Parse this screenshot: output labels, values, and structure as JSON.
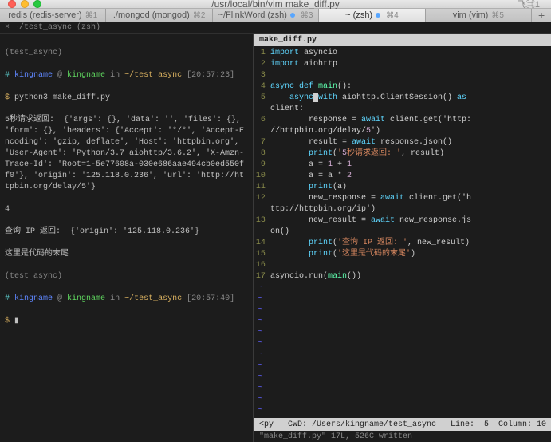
{
  "window": {
    "title": "/usr/local/bin/vim make_diff.py",
    "right_shortcut": "飞⌘1"
  },
  "tabs": [
    {
      "label": "redis (redis-server)",
      "hotkey": "⌘1",
      "indicator": null,
      "active": false
    },
    {
      "label": "./mongod (mongod)",
      "hotkey": "⌘2",
      "indicator": null,
      "active": false
    },
    {
      "label": "~/FlinkWord (zsh)",
      "hotkey": "⌘3",
      "indicator": "#58a6ff",
      "active": false
    },
    {
      "label": "~ (zsh)",
      "hotkey": "⌘4",
      "indicator": "#58a6ff",
      "active": true
    },
    {
      "label": "vim (vim)",
      "hotkey": "⌘5",
      "indicator": null,
      "active": false
    }
  ],
  "tmux_line": " × ~/test_async (zsh)",
  "left_pane": {
    "l1_env": "(test_async)",
    "l2_prefix": "# ",
    "l2_user": "kingname",
    "l2_at": " @ ",
    "l2_host": "kingname",
    "l2_in": " in ",
    "l2_path": "~/test_async",
    "l2_time": " [20:57:23]",
    "l3_prompt": "$ ",
    "l3_cmd": "python3 make_diff.py",
    "block": "5秒请求返回:  {'args': {}, 'data': '', 'files': {}, 'form': {}, 'headers': {'Accept': '*/*', 'Accept-Encoding': 'gzip, deflate', 'Host': 'httpbin.org', 'User-Agent': 'Python/3.7 aiohttp/3.6.2', 'X-Amzn-Trace-Id': 'Root=1-5e77608a-030e686aae494cb0ed550ff0'}, 'origin': '125.118.0.236', 'url': 'http://httpbin.org/delay/5'}",
    "l4": "4",
    "l5": "查询 IP 返回:  {'origin': '125.118.0.236'}",
    "l6": "这里是代码的末尾",
    "l7_env": "(test_async)",
    "l8_prefix": "# ",
    "l8_user": "kingname",
    "l8_at": " @ ",
    "l8_host": "kingname",
    "l8_in": " in ",
    "l8_path": "~/test_async",
    "l8_time": " [20:57:40]",
    "l9_prompt": "$ ",
    "l9_cursor": "▮"
  },
  "vim": {
    "filename": "make_diff.py",
    "status": "<py   CWD: /Users/kingname/test_async   Line:  5  Column: 10",
    "cmdline": "\"make_diff.py\" 17L, 526C written",
    "code": [
      "import asyncio",
      "import aiohttp",
      "",
      "async def main():",
      "    async with aiohttp.ClientSession() as client:",
      "        response = await client.get('http://httpbin.org/delay/5')",
      "        result = await response.json()",
      "        print('5秒请求返回: ', result)",
      "        a = 1 + 1",
      "        a = a * 2",
      "        print(a)",
      "        new_response = await client.get('http://httpbin.org/ip')",
      "        new_result = await new_response.json()",
      "        print('查询 IP 返回: ', new_result)",
      "        print('这里是代码的末尾')",
      "",
      "asyncio.run(main())"
    ]
  }
}
